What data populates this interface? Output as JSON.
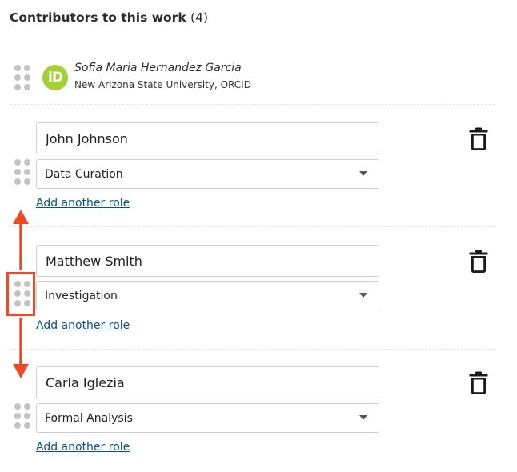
{
  "section": {
    "title": "Contributors to this work",
    "count": "(4)"
  },
  "orcid_contributor": {
    "icon": "orcid-icon",
    "icon_text": "iD",
    "icon_color": "#a6ce39",
    "name": "Sofia Maria Hernandez Garcia",
    "affiliation": "New Arizona State University, ORCID"
  },
  "contributors": [
    {
      "name": "John Johnson",
      "role": "Data Curation",
      "add_role_label": "Add another role"
    },
    {
      "name": "Matthew Smith",
      "role": "Investigation",
      "add_role_label": "Add another role"
    },
    {
      "name": "Carla Iglezia",
      "role": "Formal Analysis",
      "add_role_label": "Add another role"
    }
  ],
  "annotation": {
    "color": "#ef4a25",
    "arrows": [
      "arrow-up-icon",
      "arrow-down-icon"
    ]
  },
  "colors": {
    "link": "#0a4f86",
    "handle_dots": "#c3c3c3"
  }
}
